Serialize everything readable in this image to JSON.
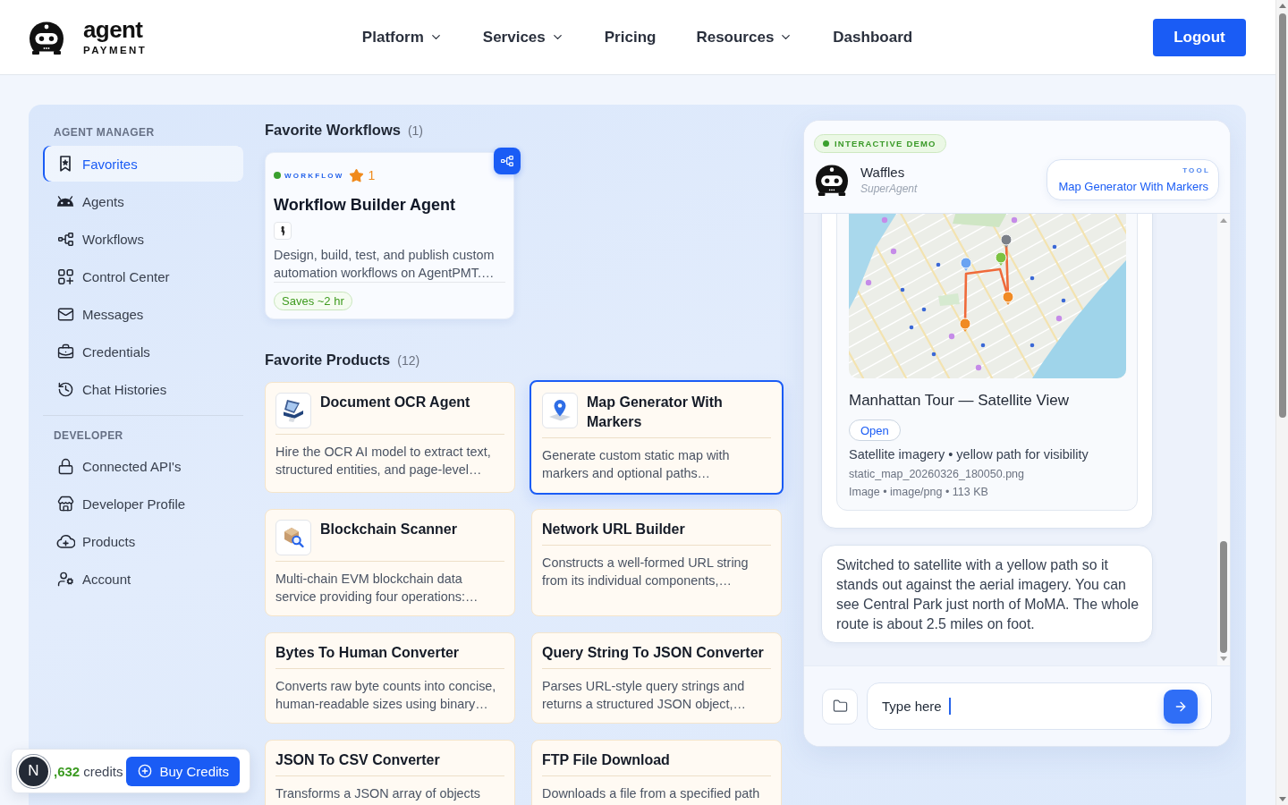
{
  "header": {
    "logo": {
      "wordmark": "agent",
      "tagline": "PAYMENT"
    },
    "nav": [
      {
        "label": "Platform",
        "dropdown": true
      },
      {
        "label": "Services",
        "dropdown": true
      },
      {
        "label": "Pricing",
        "dropdown": false
      },
      {
        "label": "Resources",
        "dropdown": true
      },
      {
        "label": "Dashboard",
        "dropdown": false
      }
    ],
    "logout_button": "Logout"
  },
  "sidebar": {
    "sections": [
      {
        "title": "AGENT MANAGER",
        "items": [
          {
            "label": "Favorites",
            "selected": true
          },
          {
            "label": "Agents",
            "selected": false
          },
          {
            "label": "Workflows",
            "selected": false
          },
          {
            "label": "Control Center",
            "selected": false
          },
          {
            "label": "Messages",
            "selected": false
          },
          {
            "label": "Credentials",
            "selected": false
          },
          {
            "label": "Chat Histories",
            "selected": false
          }
        ]
      },
      {
        "title": "DEVELOPER",
        "items": [
          {
            "label": "Connected API's",
            "selected": false
          },
          {
            "label": "Developer Profile",
            "selected": false
          },
          {
            "label": "Products",
            "selected": false
          },
          {
            "label": "Account",
            "selected": false
          }
        ]
      }
    ],
    "credits": {
      "avatar": "N",
      "amount": ",632",
      "unit": "credits",
      "buy_button": "Buy Credits"
    }
  },
  "favorite_workflows": {
    "title": "Favorite Workflows",
    "count": "(1)",
    "cards": [
      {
        "tag": "WORKFLOW",
        "star_count": "1",
        "title": "Workflow Builder Agent",
        "description": "Design, build, test, and publish custom automation workflows on AgentPMT.…",
        "savings": "Saves ~2 hr"
      }
    ]
  },
  "favorite_products": {
    "title": "Favorite Products",
    "count": "(12)",
    "cards": [
      {
        "kind": "icon",
        "title": "Document OCR Agent",
        "description": "Hire the OCR AI model to extract text, structured entities, and page-level…",
        "selected": false
      },
      {
        "kind": "icon",
        "title": "Map Generator With Markers",
        "description": "Generate custom static map with markers and optional paths…",
        "selected": true
      },
      {
        "kind": "icon",
        "title": "Blockchain Scanner",
        "description": "Multi-chain EVM blockchain data service providing four operations:…",
        "selected": false
      },
      {
        "kind": "plain",
        "title": "Network URL Builder",
        "description": "Constructs a well-formed URL string from its individual components,…",
        "selected": false
      },
      {
        "kind": "plain",
        "title": "Bytes To Human Converter",
        "description": "Converts raw byte counts into concise, human-readable sizes using binary…",
        "selected": false
      },
      {
        "kind": "plain",
        "title": "Query String To JSON Converter",
        "description": "Parses URL-style query strings and returns a structured JSON object,…",
        "selected": false
      },
      {
        "kind": "plain",
        "title": "JSON To CSV Converter",
        "description": "Transforms a JSON array of objects",
        "selected": false
      },
      {
        "kind": "plain",
        "title": "FTP File Download",
        "description": "Downloads a file from a specified path",
        "selected": false
      }
    ]
  },
  "demo": {
    "badge": "INTERACTIVE DEMO",
    "agent": {
      "name": "Waffles",
      "role": "SuperAgent"
    },
    "tool": {
      "label": "TOOL",
      "name": "Map Generator With Markers"
    },
    "messages": [
      {
        "kind": "attachment",
        "title": "Manhattan Tour — Satellite View",
        "action": "Open",
        "caption": "Satellite imagery • yellow path for visibility",
        "filename": "static_map_20260326_180050.png",
        "meta": "Image • image/png • 113 KB"
      },
      {
        "kind": "text",
        "text": "Switched to satellite with a yellow path so it stands out against the aerial imagery. You can see Central Park just north of MoMA. The whole route is about 2.5 miles on foot."
      }
    ],
    "input": {
      "value": "Type here"
    }
  }
}
